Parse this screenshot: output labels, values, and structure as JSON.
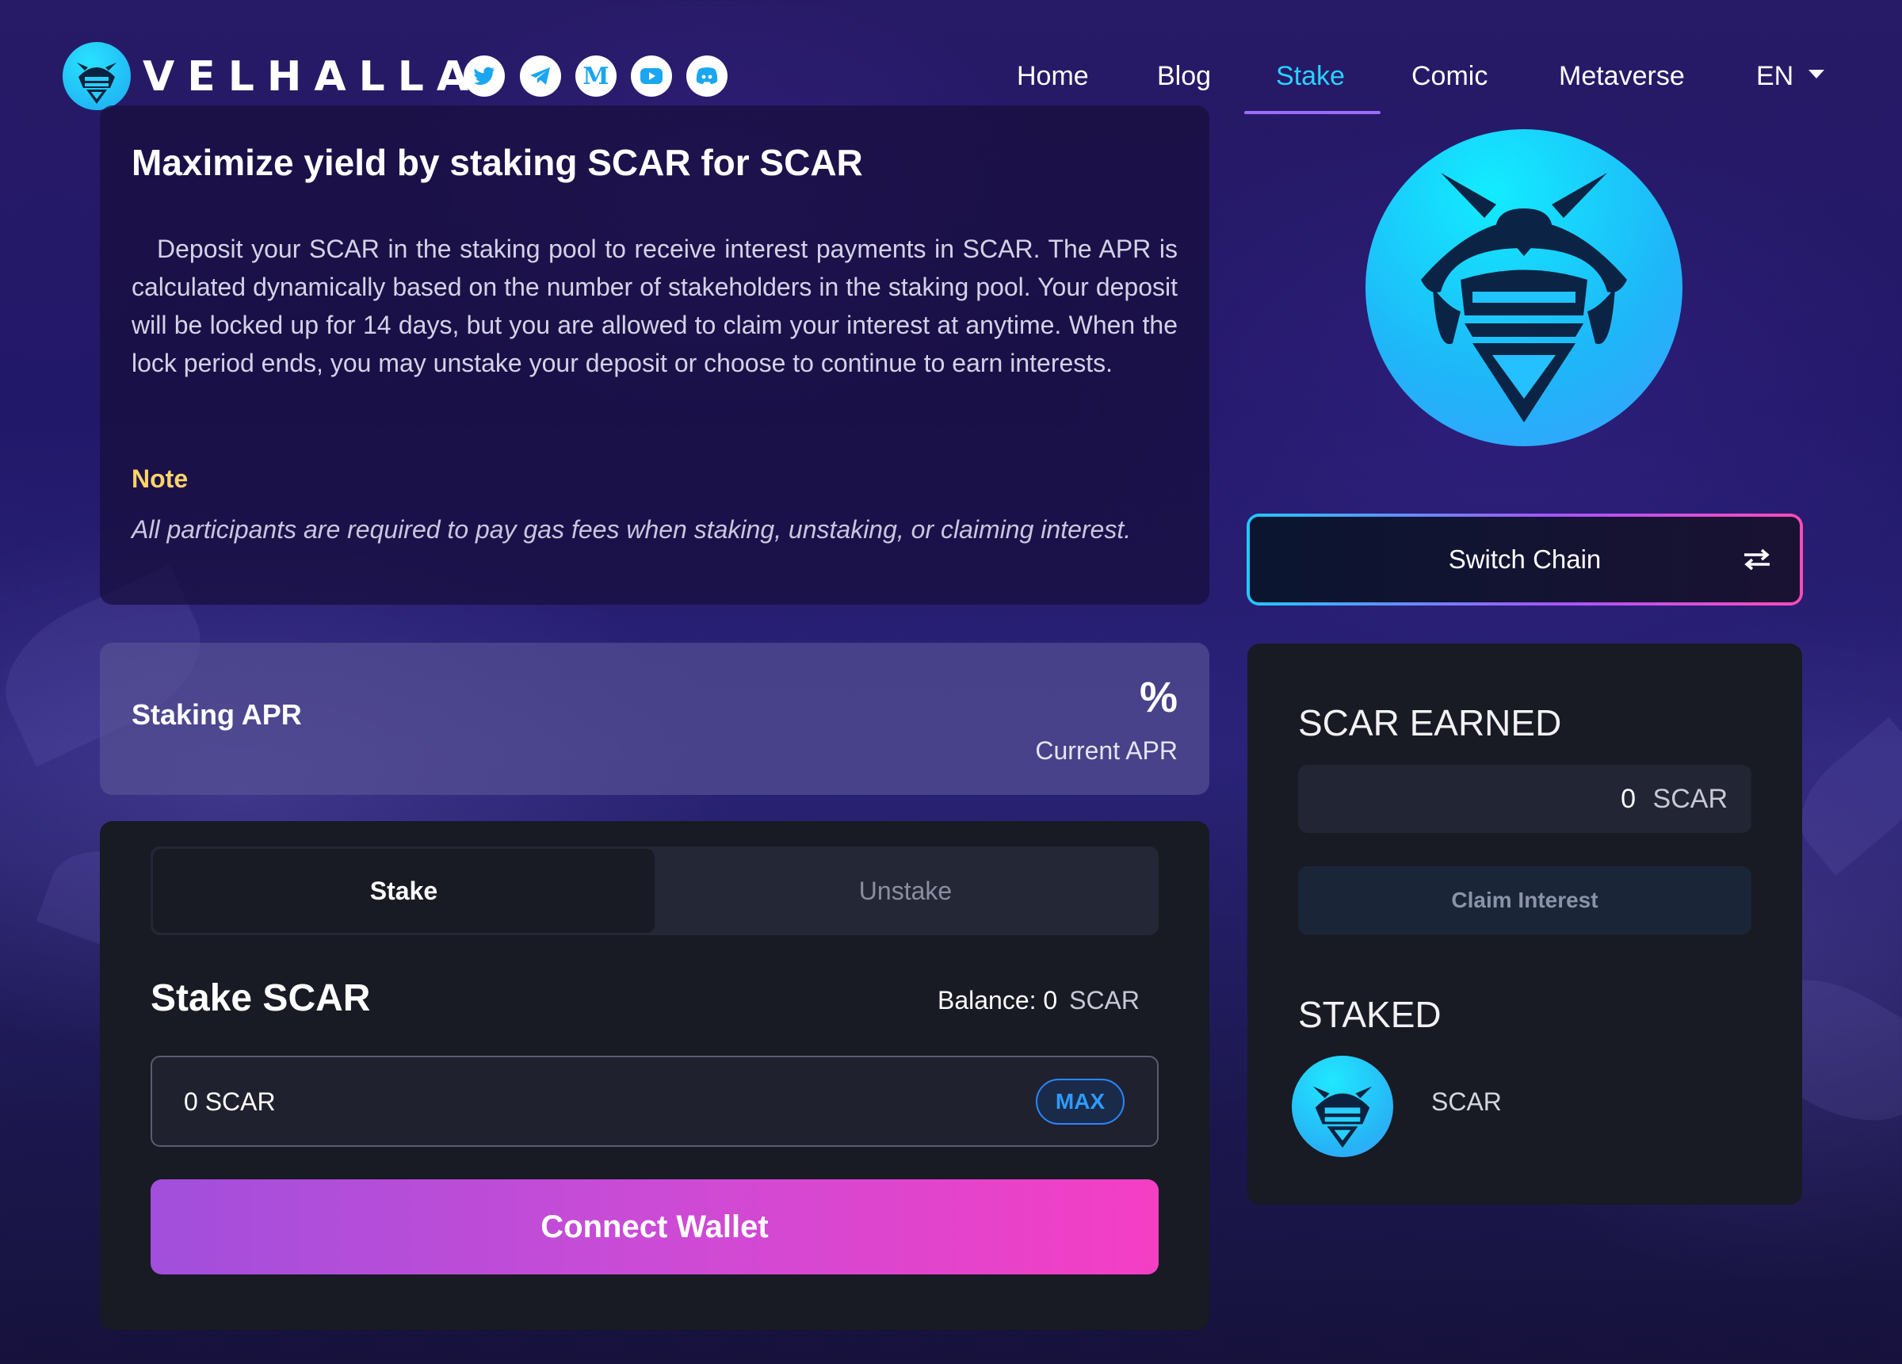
{
  "nav": {
    "brand": "VELHALLA",
    "social": [
      {
        "name": "twitter-icon"
      },
      {
        "name": "telegram-icon"
      },
      {
        "name": "medium-icon"
      },
      {
        "name": "youtube-icon"
      },
      {
        "name": "discord-icon"
      }
    ],
    "links": [
      "Home",
      "Blog",
      "Stake",
      "Comic",
      "Metaverse"
    ],
    "active_link": "Stake",
    "language": "EN"
  },
  "info": {
    "title": "Maximize yield by staking SCAR for SCAR",
    "description": "Deposit your SCAR in the staking pool to receive interest payments in SCAR. The APR is calculated dynamically based on the number of stakeholders in the staking pool. Your deposit will be locked up for 14 days, but you are allowed to claim your interest at anytime. When the lock period ends, you may unstake your deposit or choose to continue to earn interests.",
    "note_title": "Note",
    "note_text": "All participants are required to pay gas fees when staking, unstaking, or claiming interest."
  },
  "switch_chain": {
    "label": "Switch Chain",
    "icon": "swap-arrows-icon"
  },
  "apr": {
    "label": "Staking APR",
    "value": "%",
    "sublabel": "Current APR"
  },
  "stake_panel": {
    "tabs": [
      "Stake",
      "Unstake"
    ],
    "active_tab": "Stake",
    "title": "Stake SCAR",
    "balance_label": "Balance:",
    "balance_value": "0",
    "balance_currency": "SCAR",
    "amount_value": "0 SCAR",
    "max_label": "MAX",
    "connect_label": "Connect Wallet"
  },
  "earned_panel": {
    "earned_title": "SCAR EARNED",
    "earned_value": "0",
    "earned_currency": "SCAR",
    "claim_label": "Claim Interest",
    "staked_title": "STAKED",
    "staked_token": "SCAR"
  },
  "colors": {
    "accent_cyan": "#2ad1ff",
    "note_yellow": "#ffd36a",
    "connect_gradient_start": "#a14fdc",
    "connect_gradient_end": "#f43ec4",
    "max_blue": "#2e9bff"
  }
}
